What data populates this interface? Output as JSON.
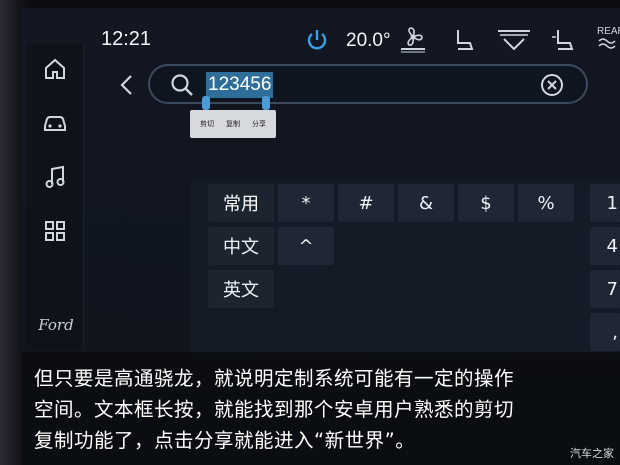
{
  "status_bar": {
    "time": "12:21",
    "temperature": "20.0°",
    "icons": [
      "power-icon",
      "fan-icon",
      "seat-heat-icon",
      "defrost-icon",
      "seat-cool-icon",
      "rear-defrost-icon"
    ],
    "rear_label": "REAR"
  },
  "sidebar": {
    "items": [
      {
        "icon": "home-icon"
      },
      {
        "icon": "car-icon"
      },
      {
        "icon": "music-icon"
      },
      {
        "icon": "apps-grid-icon"
      }
    ],
    "brand": "Ford"
  },
  "search": {
    "value": "123456",
    "context_menu": [
      "剪切",
      "复制",
      "分享"
    ]
  },
  "keyboard": {
    "categories": [
      "常用",
      "中文",
      "英文"
    ],
    "active_category": "常用",
    "row1": [
      "*",
      "#",
      "&",
      "$",
      "%",
      "1"
    ],
    "row2": [
      "^",
      "4"
    ],
    "row3": [
      "7"
    ],
    "row4": [
      ","
    ]
  },
  "caption": {
    "line1": "但只要是高通骁龙，就说明定制系统可能有一定的操作",
    "line2": "空间。文本框长按，就能找到那个安卓用户熟悉的剪切",
    "line3": "复制功能了，点击分享就能进入“新世界”。"
  },
  "watermark": "汽车之家",
  "colors": {
    "accent_orange": "#d6764a",
    "selection_blue": "#2e6e98",
    "power_blue": "#3aa0e8"
  }
}
